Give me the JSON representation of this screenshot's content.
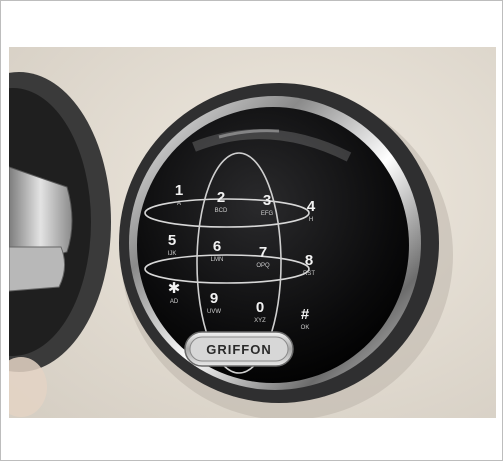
{
  "photo": {
    "subject": "electronic keypad lock",
    "brand": "GRIFFON",
    "keys": [
      {
        "num": "1",
        "sub": "A"
      },
      {
        "num": "2",
        "sub": "BCD"
      },
      {
        "num": "3",
        "sub": "EFG"
      },
      {
        "num": "4",
        "sub": "H"
      },
      {
        "num": "5",
        "sub": "IJK"
      },
      {
        "num": "6",
        "sub": "LMN"
      },
      {
        "num": "7",
        "sub": "OPQ"
      },
      {
        "num": "8",
        "sub": "RST"
      },
      {
        "num": "✱",
        "sub": "AD"
      },
      {
        "num": "9",
        "sub": "UVW"
      },
      {
        "num": "0",
        "sub": "XYZ"
      },
      {
        "num": "#",
        "sub": "OK"
      }
    ]
  }
}
